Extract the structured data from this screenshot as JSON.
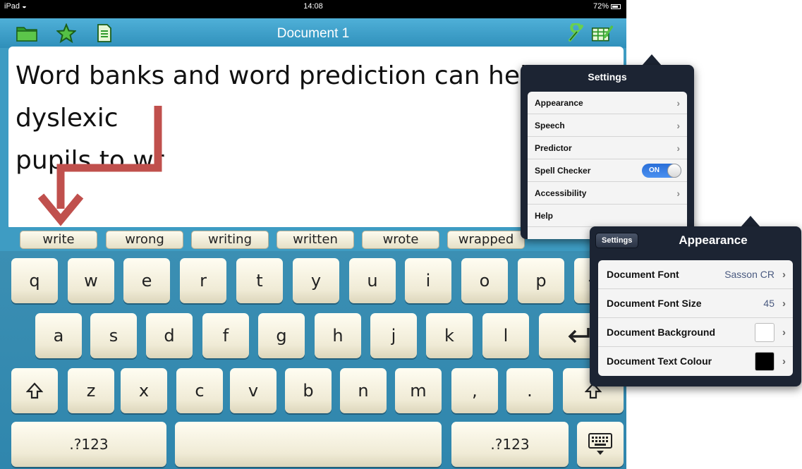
{
  "status_bar": {
    "device": "iPad",
    "time": "14:08",
    "battery": "72%"
  },
  "title_bar": {
    "title": "Document 1",
    "left_icons": [
      "folder-icon",
      "star-icon",
      "document-icon"
    ],
    "right_icons": [
      "wrench-icon",
      "word-bank-icon"
    ]
  },
  "document": {
    "text": "Word banks and word prediction can help dyslexic\npupils to wr"
  },
  "predictions": [
    "write",
    "wrong",
    "writing",
    "written",
    "wrote",
    "wrapped"
  ],
  "keyboard": {
    "row1": [
      "q",
      "w",
      "e",
      "r",
      "t",
      "y",
      "u",
      "i",
      "o",
      "p"
    ],
    "row2": [
      "a",
      "s",
      "d",
      "f",
      "g",
      "h",
      "j",
      "k",
      "l"
    ],
    "row3": [
      "z",
      "x",
      "c",
      "v",
      "b",
      "n",
      "m",
      ",",
      "."
    ],
    "numbers_left": ".?123",
    "numbers_right": ".?123",
    "icons": [
      "shift-icon",
      "return-icon",
      "hide-keyboard-icon"
    ]
  },
  "settings_popover": {
    "title": "Settings",
    "items": [
      {
        "label": "Appearance",
        "type": "link"
      },
      {
        "label": "Speech",
        "type": "link"
      },
      {
        "label": "Predictor",
        "type": "link"
      },
      {
        "label": "Spell Checker",
        "type": "toggle",
        "value": "ON"
      },
      {
        "label": "Accessibility",
        "type": "link"
      },
      {
        "label": "Help",
        "type": "link"
      }
    ]
  },
  "appearance_popover": {
    "back_label": "Settings",
    "title": "Appearance",
    "items": [
      {
        "label": "Document Font",
        "value": "Sasson CR"
      },
      {
        "label": "Document Font Size",
        "value": "45"
      },
      {
        "label": "Document Background",
        "swatch": "#ffffff"
      },
      {
        "label": "Document Text Colour",
        "swatch": "#000000"
      }
    ]
  },
  "colors": {
    "toolbar_blue": "#3e9cc3",
    "key_cream": "#f4efdb",
    "annotation_arrow": "#c0504d",
    "popover_dark": "#1c2433",
    "toggle_blue": "#2a6fd8"
  }
}
